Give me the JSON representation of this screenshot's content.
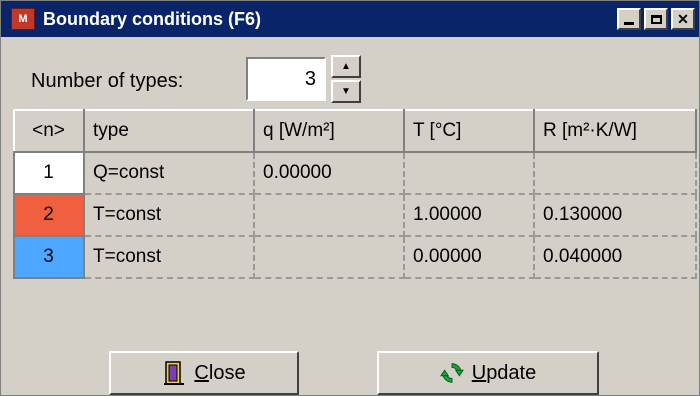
{
  "window": {
    "title": "Boundary conditions (F6)",
    "controls": [
      "minimize",
      "maximize",
      "close"
    ],
    "colors": {
      "titlebar": "#0a246a",
      "face": "#d4d0c8"
    }
  },
  "number_of_types": {
    "label": "Number of types:",
    "value": "3"
  },
  "table": {
    "headers": [
      "<n>",
      "type",
      "q [W/m²]",
      "T [°C]",
      "R [m²·K/W]"
    ],
    "rows": [
      {
        "n": "1",
        "type": "Q=const",
        "q": "0.00000",
        "T": "",
        "R": "",
        "swatch_color": "#ffffff"
      },
      {
        "n": "2",
        "type": "T=const",
        "q": "",
        "T": "1.00000",
        "R": "0.130000",
        "swatch_color": "#f06040"
      },
      {
        "n": "3",
        "type": "T=const",
        "q": "",
        "T": "0.00000",
        "R": "0.040000",
        "swatch_color": "#4da6ff"
      }
    ]
  },
  "buttons": {
    "close": {
      "label_first": "C",
      "label_rest": "lose",
      "icon": "door-exit-icon"
    },
    "update": {
      "label_first": "U",
      "label_rest": "pdate",
      "icon": "refresh-icon"
    }
  }
}
